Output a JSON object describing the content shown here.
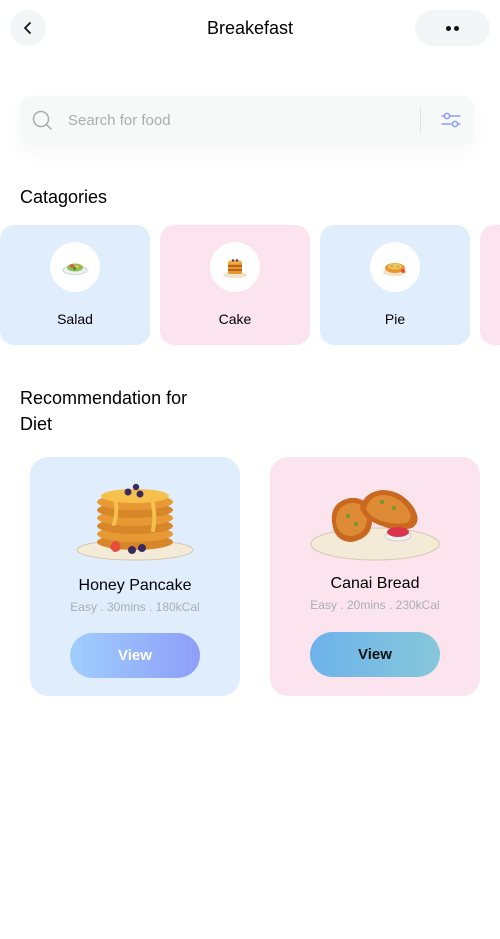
{
  "header": {
    "title": "Breakefast"
  },
  "search": {
    "placeholder": "Search for food"
  },
  "sections": {
    "categories": "Catagories",
    "recommendation": "Recommendation for Diet"
  },
  "categories": [
    {
      "label": "Salad",
      "color": "#e0edfd"
    },
    {
      "label": "Cake",
      "color": "#fce4ef"
    },
    {
      "label": "Pie",
      "color": "#e0edfd"
    }
  ],
  "recommendations": [
    {
      "name": "Honey Pancake",
      "meta": "Easy . 30mins . 180kCal",
      "button": "View"
    },
    {
      "name": "Canai Bread",
      "meta": "Easy . 20mins . 230kCal",
      "button": "View"
    }
  ],
  "colors": {
    "accent": "#8e9ef8",
    "blue_card": "#e0edfd",
    "pink_card": "#fce4ef"
  }
}
